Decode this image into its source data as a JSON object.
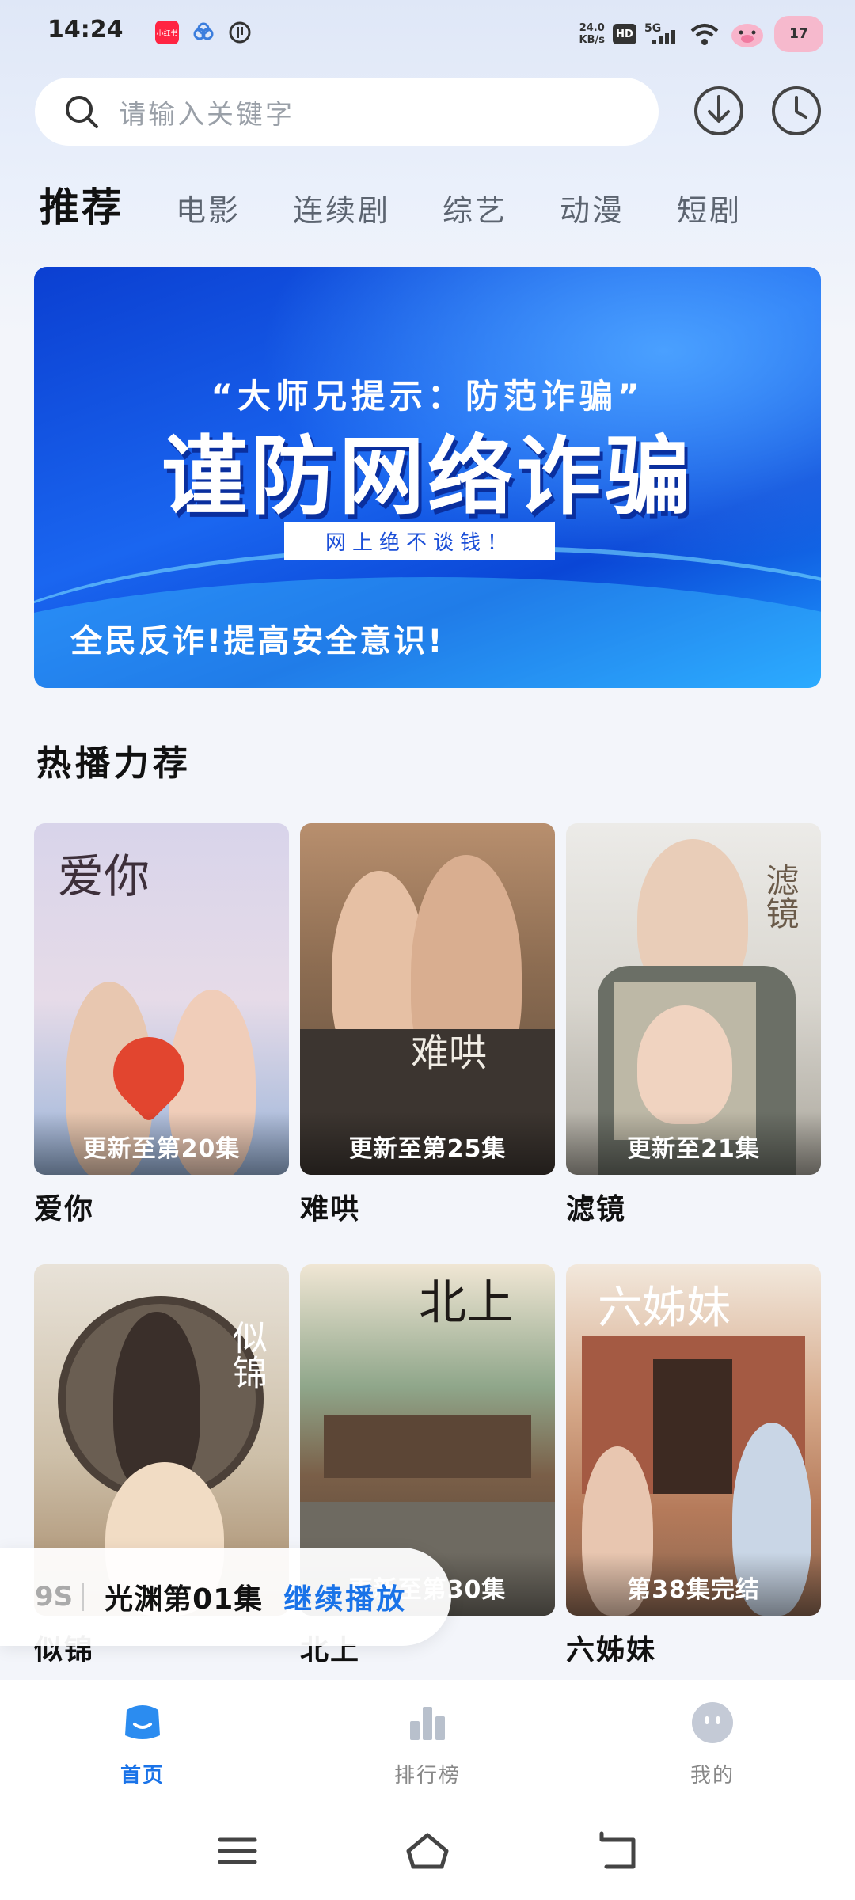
{
  "status_bar": {
    "time": "14:24",
    "app_icon_label": "小红书",
    "net_speed_value": "24.0",
    "net_speed_unit": "KB/s",
    "hd": "HD",
    "network": "5G",
    "battery": "17",
    "icons": [
      "xiaohongshu-app-icon",
      "cloud-app-icon",
      "notification-app-icon",
      "wifi-icon",
      "pig-sticker-icon",
      "battery-icon"
    ]
  },
  "search": {
    "placeholder": "请输入关键字",
    "icon": "search-icon"
  },
  "top_actions": {
    "download_icon": "download-icon",
    "history_icon": "history-clock-icon"
  },
  "tabs": [
    "推荐",
    "电影",
    "连续剧",
    "综艺",
    "动漫",
    "短剧"
  ],
  "active_tab": "推荐",
  "banner": {
    "subtitle": "“大师兄提示：防范诈骗”",
    "title": "谨防网络诈骗",
    "box_text": "网上绝不谈钱！",
    "footer": "全民反诈!提高安全意识!"
  },
  "section": {
    "title": "热播力荐"
  },
  "cards": [
    {
      "title": "爱你",
      "badge": "更新至第20集",
      "poster_text": "爱你"
    },
    {
      "title": "难哄",
      "badge": "更新至第25集",
      "poster_text": "难哄"
    },
    {
      "title": "滤镜",
      "badge": "更新至21集",
      "poster_text": "滤镜"
    },
    {
      "title": "似锦",
      "badge": "",
      "poster_text": "似锦"
    },
    {
      "title": "北上",
      "badge": "更新至第30集",
      "poster_text": "北上"
    },
    {
      "title": "六姊妹",
      "badge": "第38集完结",
      "poster_text": "六姊妹"
    }
  ],
  "continue_play": {
    "episode_partial": "9S",
    "title": "光渊第01集",
    "button": "继续播放"
  },
  "bottom_nav": [
    {
      "label": "首页",
      "icon": "home-tv-icon",
      "active": true
    },
    {
      "label": "排行榜",
      "icon": "ranking-bars-icon",
      "active": false
    },
    {
      "label": "我的",
      "icon": "profile-face-icon",
      "active": false
    }
  ],
  "system_nav": {
    "menu_icon": "menu-icon",
    "home_icon": "home-icon",
    "back_icon": "back-icon"
  },
  "colors": {
    "accent": "#1a73e8",
    "banner_blue": "#1a66f0"
  }
}
